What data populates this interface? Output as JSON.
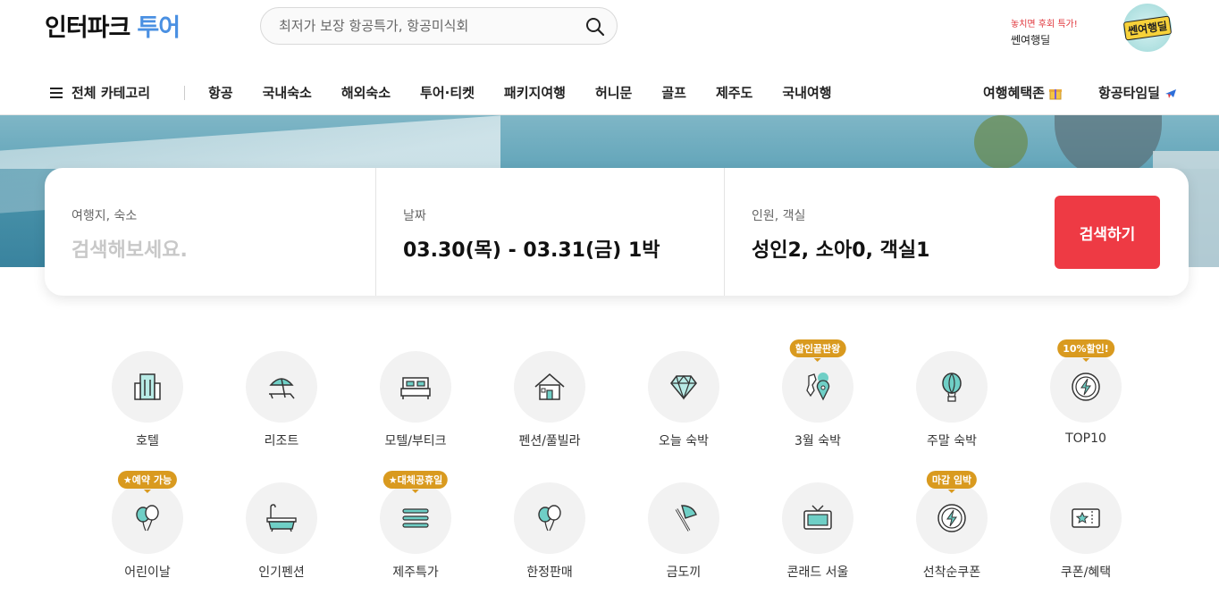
{
  "header": {
    "logo_main": "인터파크",
    "logo_sub": "투어",
    "search_placeholder": "최저가 보장 항공특가, 항공미식회",
    "promo_line1": "놓치면 후회 특가!",
    "promo_line2": "쎈여행딜",
    "badge_text": "쎈여행딜"
  },
  "nav": {
    "category_label": "전체 카테고리",
    "items": [
      "항공",
      "국내숙소",
      "해외숙소",
      "투어·티켓",
      "패키지여행",
      "허니문",
      "골프",
      "제주도",
      "국내여행"
    ],
    "right_items": [
      {
        "label": "여행혜택존",
        "icon": "gift-icon"
      },
      {
        "label": "항공타임딜",
        "icon": "airplane-icon"
      }
    ]
  },
  "booking": {
    "destination_label": "여행지, 숙소",
    "destination_placeholder": "검색해보세요.",
    "date_label": "날짜",
    "date_value": "03.30(목) - 03.31(금) 1박",
    "guest_label": "인원, 객실",
    "guest_value": "성인2, 소아0, 객실1",
    "search_button": "검색하기"
  },
  "categories": [
    {
      "label": "호텔",
      "icon": "hotel-icon",
      "tag": ""
    },
    {
      "label": "리조트",
      "icon": "umbrella-icon",
      "tag": ""
    },
    {
      "label": "모텔/부티크",
      "icon": "bed-icon",
      "tag": ""
    },
    {
      "label": "펜션/풀빌라",
      "icon": "house-icon",
      "tag": ""
    },
    {
      "label": "오늘 숙박",
      "icon": "diamond-icon",
      "tag": ""
    },
    {
      "label": "3월 숙박",
      "icon": "map-pin-icon",
      "tag": "할인끝판왕"
    },
    {
      "label": "주말 숙박",
      "icon": "balloon-icon",
      "tag": ""
    },
    {
      "label": "TOP10",
      "icon": "lightning-icon",
      "tag": "10%할인!"
    },
    {
      "label": "어린이날",
      "icon": "balloons-icon",
      "tag": "★예약 가능"
    },
    {
      "label": "인기펜션",
      "icon": "bathtub-icon",
      "tag": ""
    },
    {
      "label": "제주특가",
      "icon": "menu-lines-icon",
      "tag": "★대체공휴일"
    },
    {
      "label": "한정판매",
      "icon": "balloons-icon",
      "tag": ""
    },
    {
      "label": "금도끼",
      "icon": "axe-icon",
      "tag": ""
    },
    {
      "label": "콘래드 서울",
      "icon": "tv-icon",
      "tag": ""
    },
    {
      "label": "선착순쿠폰",
      "icon": "lightning-icon",
      "tag": "마감 임박"
    },
    {
      "label": "쿠폰/혜택",
      "icon": "ticket-icon",
      "tag": ""
    }
  ],
  "colors": {
    "accent": "#ee3a44",
    "logo_blue": "#4a90e2",
    "tag": "#d99a1f",
    "icon_teal": "#6fcfc6"
  }
}
